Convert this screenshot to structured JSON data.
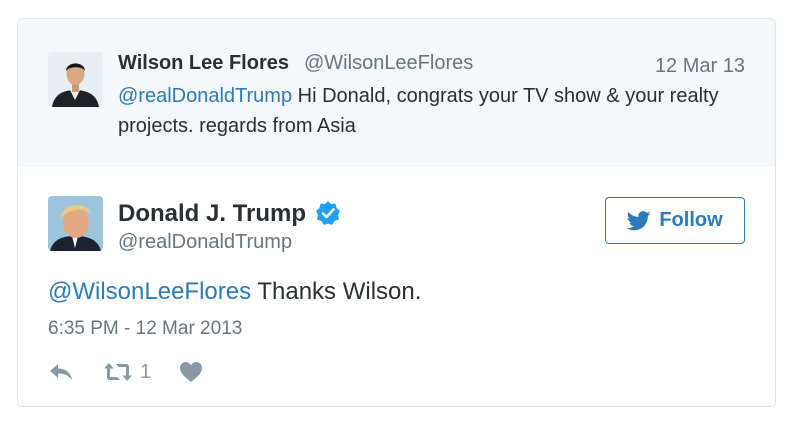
{
  "parent_tweet": {
    "author_name": "Wilson Lee Flores",
    "author_handle": "@WilsonLeeFlores",
    "date": "12 Mar 13",
    "mention": "@realDonaldTrump",
    "text": " Hi Donald, congrats your TV show & your realty projects. regards from Asia",
    "avatar_icon": "person-photo-icon"
  },
  "main_tweet": {
    "author_name": "Donald J. Trump",
    "author_handle": "@realDonaldTrump",
    "verified_icon": "verified-badge-icon",
    "follow_label": "Follow",
    "mention": "@WilsonLeeFlores",
    "text": " Thanks Wilson.",
    "timestamp": "6:35 PM - 12 Mar 2013",
    "retweet_count": "1",
    "avatar_icon": "person-photo-icon"
  },
  "colors": {
    "link": "#2b7bb9",
    "muted": "#66757f",
    "text": "#292f33",
    "parent_bg": "#f5f8fa",
    "verified": "#1da1f2",
    "action_gray": "#8899a6"
  }
}
